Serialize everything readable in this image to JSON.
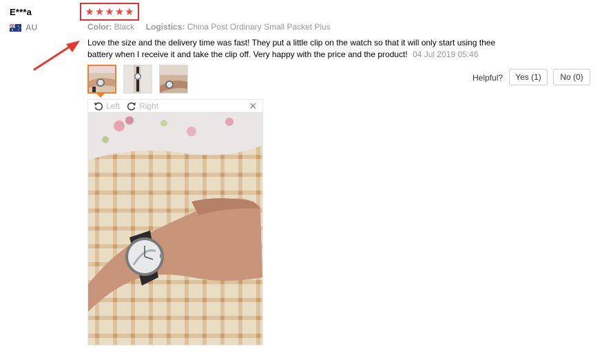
{
  "reviewer": {
    "name": "E***a",
    "country_code": "AU",
    "flag_icon": "australia-flag-icon"
  },
  "rating": {
    "stars": 5,
    "max": 5,
    "star_color": "#f5463c",
    "highlight_color": "#e03030"
  },
  "meta": {
    "color_label": "Color:",
    "color_value": "Black",
    "logistics_label": "Logistics:",
    "logistics_value": "China Post Ordinary Small Packet Plus"
  },
  "review": {
    "text": "Love the size and the delivery time was fast! They put a little clip on the watch so that it will only start using thee battery when I receive it and take the clip off. Very happy with the price and the product!",
    "date": "04 Jul 2019 05:46"
  },
  "thumbnails": [
    {
      "icon": "watch-photo-thumbnail-1",
      "active": true
    },
    {
      "icon": "watch-photo-thumbnail-2",
      "active": false
    },
    {
      "icon": "watch-photo-thumbnail-3",
      "active": false
    }
  ],
  "helpful": {
    "label": "Helpful?",
    "yes_label": "Yes (1)",
    "no_label": "No (0)"
  },
  "viewer": {
    "rotate_left_label": "Left",
    "rotate_right_label": "Right",
    "close_icon": "close-icon",
    "image_icon": "watch-on-wrist-photo"
  },
  "annotation": {
    "arrow_color": "#e8382e"
  }
}
